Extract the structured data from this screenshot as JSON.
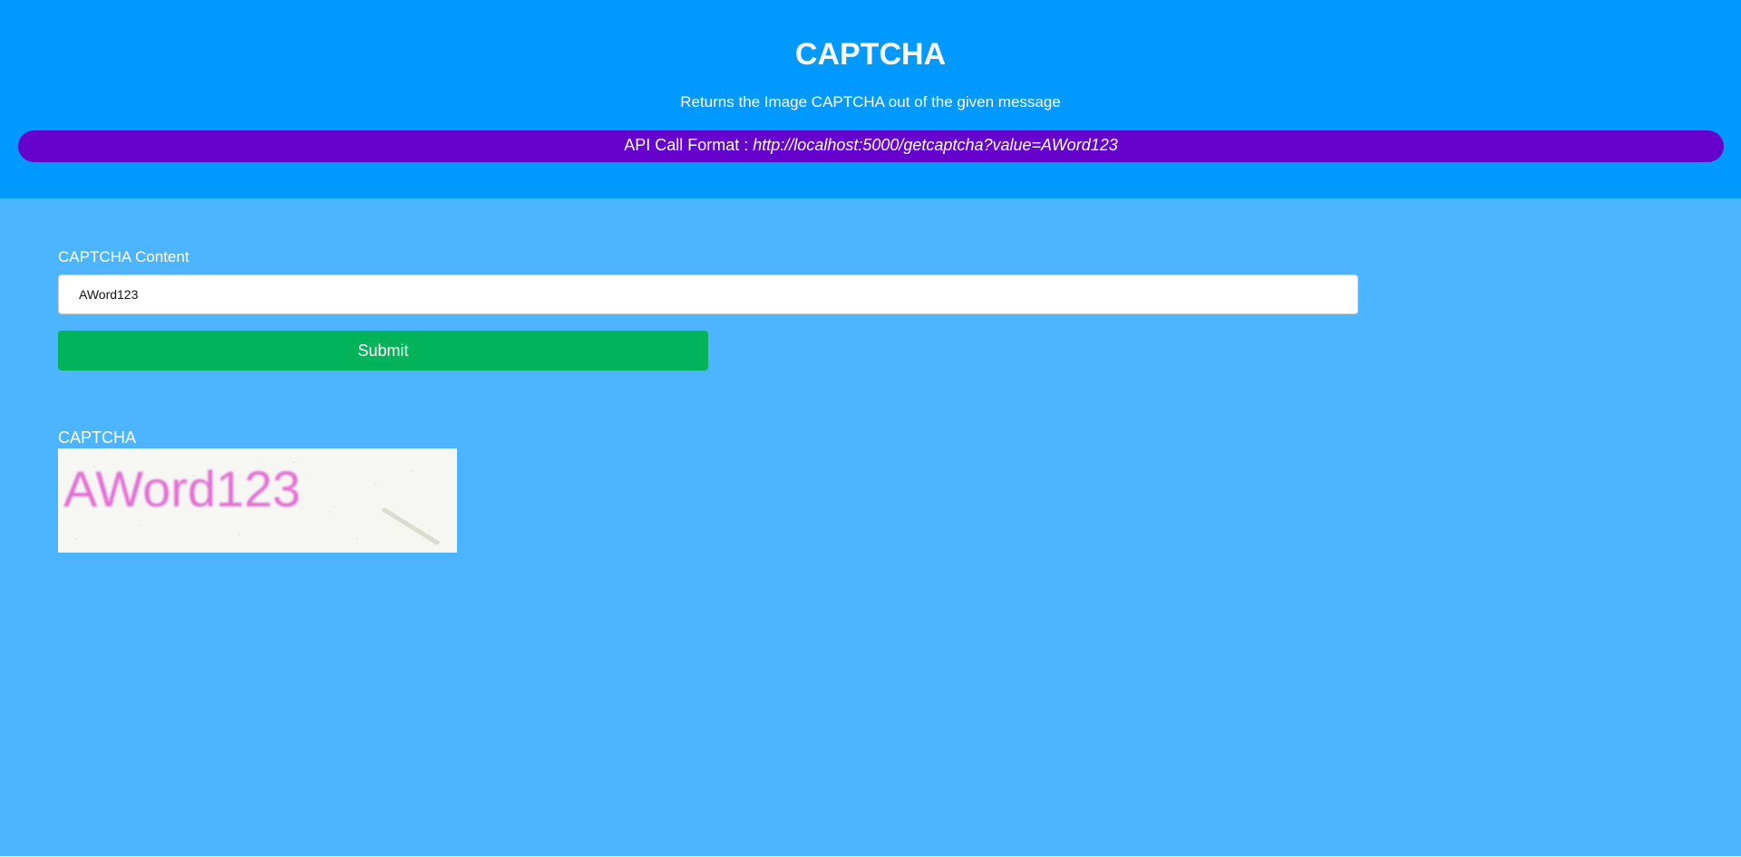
{
  "header": {
    "title": "CAPTCHA",
    "subtitle": "Returns the Image CAPTCHA out of the given message",
    "api_prefix": "API Call Format : ",
    "api_url": "http://localhost:5000/getcaptcha?value=AWord123"
  },
  "form": {
    "content_label": "CAPTCHA Content",
    "content_value": "AWord123",
    "submit_label": "Submit"
  },
  "result": {
    "label": "CAPTCHA",
    "captcha_text": "AWord123",
    "captcha_text_color": "#e36fd6"
  },
  "colors": {
    "header_bg": "#0099ff",
    "main_bg": "#4db5ff",
    "pill_bg": "#6600cc",
    "submit_bg": "#00b35a"
  }
}
